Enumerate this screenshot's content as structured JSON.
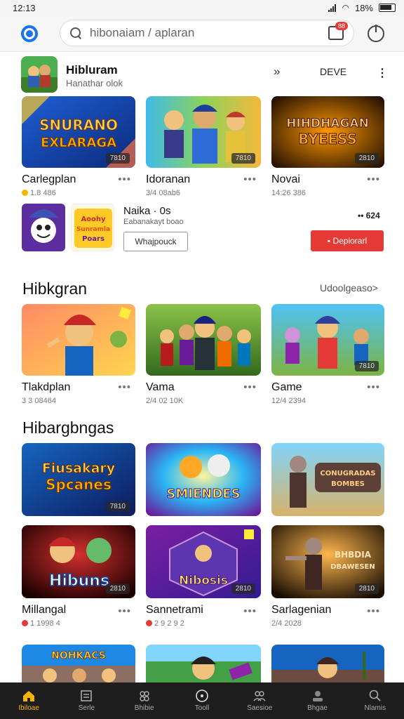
{
  "status": {
    "time": "12:13",
    "battery": "18%"
  },
  "search": {
    "placeholder": "hibonaiam / aplaran"
  },
  "notifications": {
    "badge": "88"
  },
  "featured": {
    "title": "Hibluram",
    "subtitle": "Hanathar olok",
    "action_label": "DEVE"
  },
  "row1": [
    {
      "art_text_1": "SNURANO",
      "art_text_2": "EXLARAGA",
      "badge": "7810",
      "title": "Carlegplan",
      "meta": "1.8 486"
    },
    {
      "art_text_1": "",
      "art_text_2": "",
      "badge": "7810",
      "title": "Idoranan",
      "meta": "3/4 08ab6"
    },
    {
      "art_text_1": "HIHDHAGAN",
      "art_text_2": "BYEESS",
      "badge": "2810",
      "title": "Novai",
      "meta": "14:26 386"
    }
  ],
  "promo": {
    "title": "Naika · 0s",
    "subtitle": "Eabanakayt boao",
    "button_label": "Whajpouck",
    "count": "•• 624",
    "red_button_label": "▪ Depiorarl",
    "art_text_1": "Aoohy",
    "art_text_2": "Sunramla",
    "art_text_3": "Poars"
  },
  "section2": {
    "title": "Hibkgran",
    "link": "Udoolgeaso>"
  },
  "row2": [
    {
      "badge": "",
      "title": "Tlakdplan",
      "meta": "3 3 08464"
    },
    {
      "badge": "",
      "title": "Vama",
      "meta": "2/4 02 10K"
    },
    {
      "badge": "7810",
      "title": "Game",
      "meta": "12/4 2394"
    }
  ],
  "section3": {
    "title": "Hibargbngas"
  },
  "row3": [
    {
      "art_text_1": "Fiusakary",
      "art_text_2": "Spcanes",
      "badge": "7810"
    },
    {
      "art_text_1": "SMIENDES",
      "art_text_2": "",
      "badge": ""
    },
    {
      "art_text_1": "CONUGRADAS",
      "art_text_2": "BOMBES",
      "badge": ""
    }
  ],
  "row4": [
    {
      "art_text_1": "Hibuns",
      "badge": "2810",
      "title": "Millangal",
      "meta": "1 1998 4"
    },
    {
      "art_text_1": "Nibosis",
      "badge": "2810",
      "title": "Sannetrami",
      "meta": "2 9 2 9 2"
    },
    {
      "art_text_1": "BHBDIA",
      "art_text_2": "DBAWESEN",
      "badge": "2810",
      "title": "Sarlagenian",
      "meta": "2/4 2028"
    }
  ],
  "row5": [
    {
      "art_text_1": "NOHKACS"
    },
    {
      "art_text_1": ""
    },
    {
      "art_text_1": ""
    }
  ],
  "nav": [
    {
      "label": "Ibiloae",
      "icon": "home-icon"
    },
    {
      "label": "Serle",
      "icon": "library-icon"
    },
    {
      "label": "Bhibie",
      "icon": "games-icon"
    },
    {
      "label": "Tooll",
      "icon": "target-icon"
    },
    {
      "label": "Saesioe",
      "icon": "people-icon"
    },
    {
      "label": "Bhgae",
      "icon": "profile-icon"
    },
    {
      "label": "Nlamis",
      "icon": "search-icon"
    }
  ],
  "colors": {
    "accent": "#1a73e8",
    "red": "#e53935",
    "nav_active": "#f4b400"
  }
}
